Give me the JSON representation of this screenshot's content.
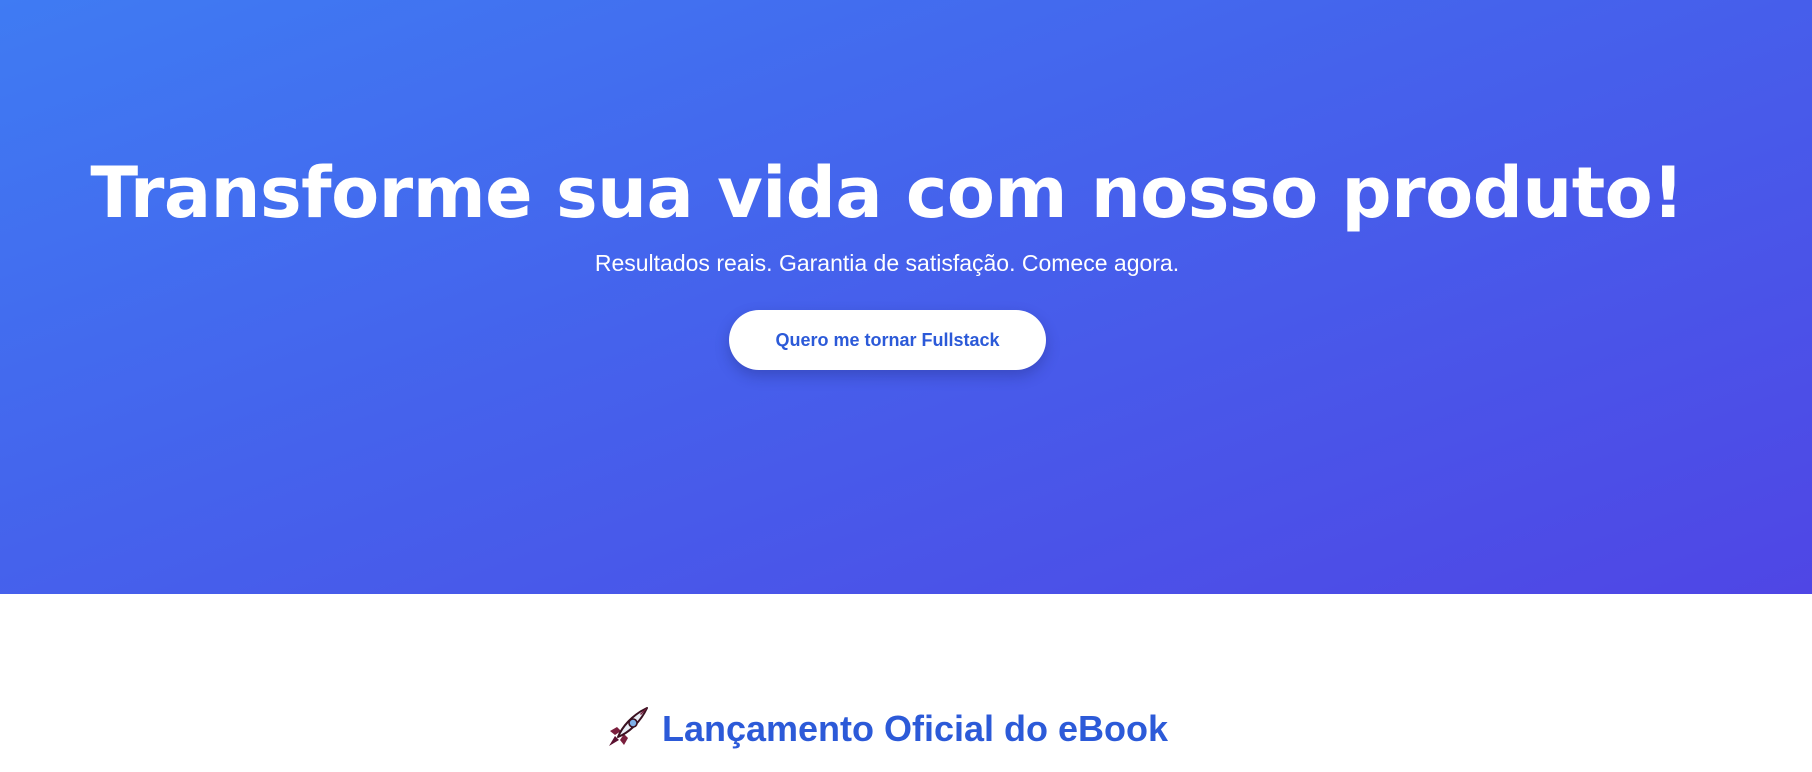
{
  "hero": {
    "title": "Transforme sua vida com nosso produto!",
    "subtitle": "Resultados reais. Garantia de satisfação. Comece agora.",
    "cta_label": "Quero me tornar Fullstack"
  },
  "launch": {
    "icon": "rocket-icon",
    "heading": "Lançamento Oficial do eBook"
  },
  "colors": {
    "gradient_start": "#3f7bf3",
    "gradient_end": "#4f46e5",
    "accent_text": "#2c5ad8",
    "background": "#ffffff"
  }
}
